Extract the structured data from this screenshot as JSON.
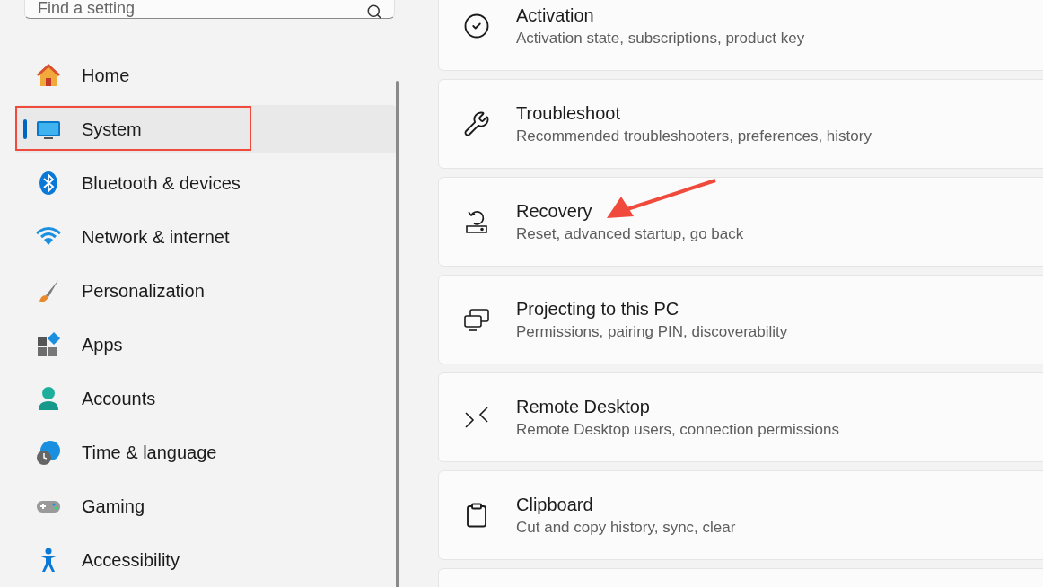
{
  "search": {
    "placeholder": "Find a setting"
  },
  "nav": [
    {
      "label": "Home",
      "selected": false,
      "highlighted": false
    },
    {
      "label": "System",
      "selected": true,
      "highlighted": true
    },
    {
      "label": "Bluetooth & devices",
      "selected": false,
      "highlighted": false
    },
    {
      "label": "Network & internet",
      "selected": false,
      "highlighted": false
    },
    {
      "label": "Personalization",
      "selected": false,
      "highlighted": false
    },
    {
      "label": "Apps",
      "selected": false,
      "highlighted": false
    },
    {
      "label": "Accounts",
      "selected": false,
      "highlighted": false
    },
    {
      "label": "Time & language",
      "selected": false,
      "highlighted": false
    },
    {
      "label": "Gaming",
      "selected": false,
      "highlighted": false
    },
    {
      "label": "Accessibility",
      "selected": false,
      "highlighted": false
    }
  ],
  "cards": [
    {
      "title": "Activation",
      "description": "Activation state, subscriptions, product key",
      "pointed_at": false
    },
    {
      "title": "Troubleshoot",
      "description": "Recommended troubleshooters, preferences, history",
      "pointed_at": false
    },
    {
      "title": "Recovery",
      "description": "Reset, advanced startup, go back",
      "pointed_at": true
    },
    {
      "title": "Projecting to this PC",
      "description": "Permissions, pairing PIN, discoverability",
      "pointed_at": false
    },
    {
      "title": "Remote Desktop",
      "description": "Remote Desktop users, connection permissions",
      "pointed_at": false
    },
    {
      "title": "Clipboard",
      "description": "Cut and copy history, sync, clear",
      "pointed_at": false
    },
    {
      "pointed_at": false
    }
  ]
}
